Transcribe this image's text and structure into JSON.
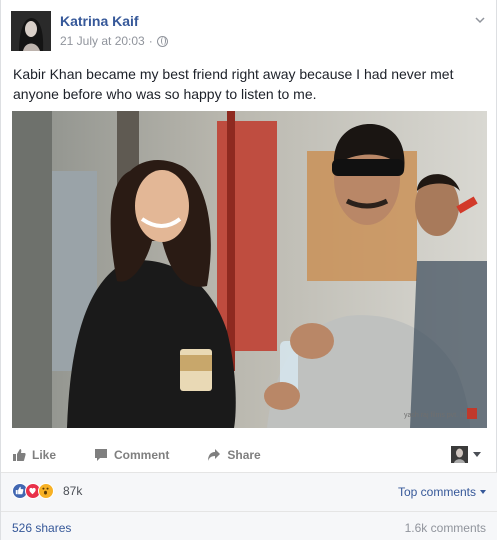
{
  "post": {
    "author": "Katrina Kaif",
    "timestamp": "21 July at 20:03",
    "separator": "·",
    "text": "Kabir Khan became my best friend right away because I had never met anyone before who was so happy to listen to me.",
    "photo_watermark": "yash raj films pvt. ltd."
  },
  "actions": {
    "like_label": "Like",
    "comment_label": "Comment",
    "share_label": "Share"
  },
  "reactions": {
    "icons": [
      "like-reaction-icon",
      "love-reaction-icon",
      "wow-reaction-icon"
    ],
    "count": "87k",
    "sort_label": "Top comments"
  },
  "stats": {
    "shares": "526 shares",
    "comments": "1.6k comments"
  },
  "colors": {
    "link_blue": "#365899",
    "meta_gray": "#90949c",
    "like_blue": "#4267b2",
    "love_red": "#e9314a",
    "wow_yellow": "#f7b125",
    "footer_bg": "#f6f7f9"
  }
}
